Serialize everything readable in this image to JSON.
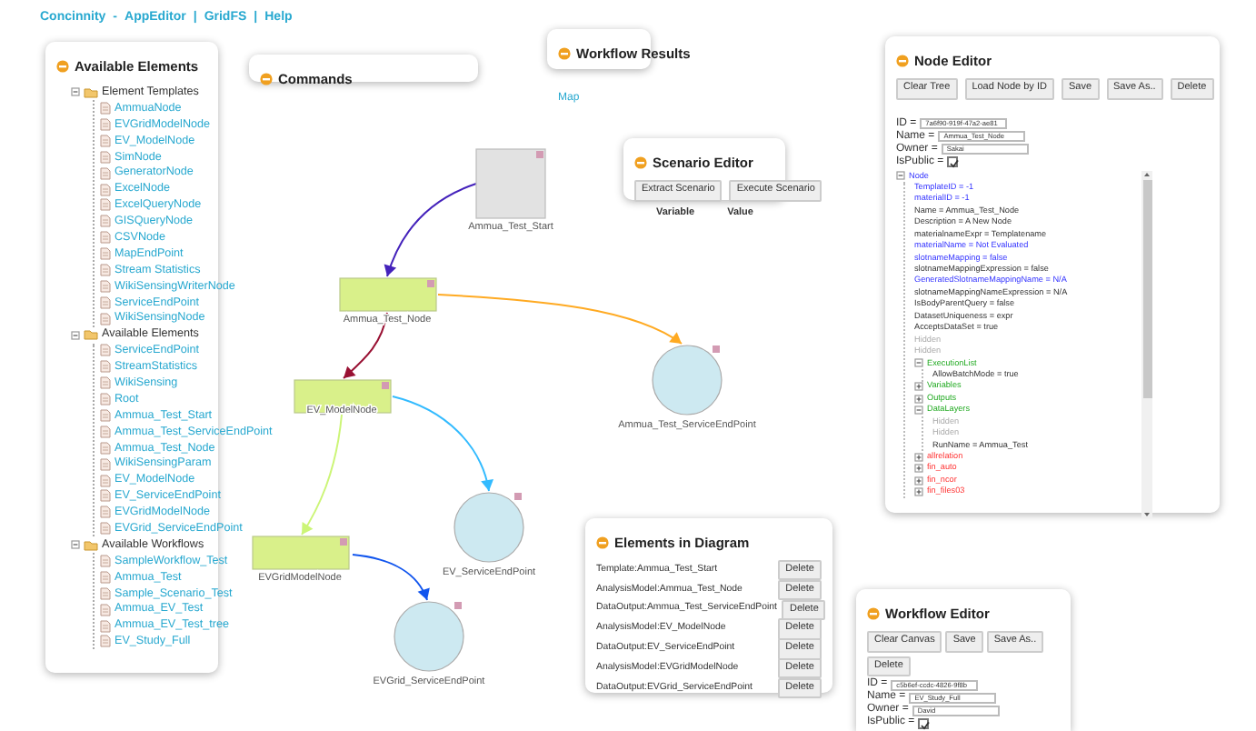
{
  "top_nav": {
    "links": [
      "Concinnity",
      "AppEditor",
      "GridFS",
      "Help"
    ],
    "separators": [
      "-",
      "|",
      "|"
    ]
  },
  "available_elements": {
    "title": "Available Elements",
    "tree": [
      {
        "label": "Element Templates",
        "expanded": true,
        "children": [
          {
            "label": "AmmuaNode"
          },
          {
            "label": "EVGridModelNode"
          },
          {
            "label": "EV_ModelNode"
          },
          {
            "label": "SimNode"
          },
          {
            "label": "GeneratorNode"
          },
          {
            "label": "ExcelNode"
          },
          {
            "label": "ExcelQueryNode"
          },
          {
            "label": "GISQueryNode"
          },
          {
            "label": "CSVNode"
          },
          {
            "label": "MapEndPoint"
          },
          {
            "label": "Stream Statistics"
          },
          {
            "label": "WikiSensingWriterNode"
          },
          {
            "label": "ServiceEndPoint"
          },
          {
            "label": "WikiSensingNode"
          }
        ]
      },
      {
        "label": "Available Elements",
        "expanded": true,
        "children": [
          {
            "label": "ServiceEndPoint"
          },
          {
            "label": "StreamStatistics"
          },
          {
            "label": "WikiSensing"
          },
          {
            "label": "Root"
          },
          {
            "label": "Ammua_Test_Start"
          },
          {
            "label": "Ammua_Test_ServiceEndPoint"
          },
          {
            "label": "Ammua_Test_Node"
          },
          {
            "label": "WikiSensingParam"
          },
          {
            "label": "EV_ModelNode"
          },
          {
            "label": "EV_ServiceEndPoint"
          },
          {
            "label": "EVGridModelNode"
          },
          {
            "label": "EVGrid_ServiceEndPoint"
          }
        ]
      },
      {
        "label": "Available Workflows",
        "expanded": true,
        "children": [
          {
            "label": "SampleWorkflow_Test"
          },
          {
            "label": "Ammua_Test"
          },
          {
            "label": "Sample_Scenario_Test"
          },
          {
            "label": "Ammua_EV_Test"
          },
          {
            "label": "Ammua_EV_Test_tree"
          },
          {
            "label": "EV_Study_Full"
          }
        ]
      }
    ]
  },
  "commands": {
    "title": "Commands"
  },
  "workflow_results": {
    "title": "Workflow Results",
    "links": [
      "Map"
    ]
  },
  "scenario_editor": {
    "title": "Scenario Editor",
    "buttons": [
      "Extract Scenario",
      "Execute Scenario"
    ],
    "columns": [
      "Variable",
      "Value"
    ]
  },
  "diagram": {
    "nodes": [
      {
        "label": "Ammua_Test_Start",
        "kind": "template"
      },
      {
        "label": "Ammua_Test_Node",
        "kind": "model"
      },
      {
        "label": "EV_ModelNode",
        "kind": "model"
      },
      {
        "label": "EVGridModelNode",
        "kind": "model"
      },
      {
        "label": "Ammua_Test_ServiceEndPoint",
        "kind": "endpoint"
      },
      {
        "label": "EV_ServiceEndPoint",
        "kind": "endpoint"
      },
      {
        "label": "EVGrid_ServiceEndPoint",
        "kind": "endpoint"
      }
    ],
    "edges": [
      {
        "color": "#4422bb"
      },
      {
        "color": "#ffaa22"
      },
      {
        "color": "#991133"
      },
      {
        "color": "#33bbff"
      },
      {
        "color": "#ccf577"
      },
      {
        "color": "#1155ee"
      }
    ]
  },
  "node_editor": {
    "title": "Node Editor",
    "buttons": [
      "Clear Tree",
      "Load Node by ID",
      "Save",
      "Save As..",
      "Delete"
    ],
    "fields": [
      {
        "label": "ID =",
        "value": "7a6f90-919f-47a2-ae81"
      },
      {
        "label": "Name =",
        "value": "Ammua_Test_Node"
      },
      {
        "label": "Owner =",
        "value": "Sakai"
      }
    ],
    "is_public": {
      "label": "IsPublic =",
      "checked": true
    },
    "tree": [
      {
        "label": "Node",
        "kind": "special",
        "expanded": true,
        "children": [
          {
            "label": "TemplateID = -1",
            "kind": "special"
          },
          {
            "label": "materialID = -1",
            "kind": "special"
          },
          {
            "label": "Name = Ammua_Test_Node",
            "kind": "plain"
          },
          {
            "label": "Description = A New Node",
            "kind": "plain"
          },
          {
            "label": "materialnameExpr = Templatename",
            "kind": "plain"
          },
          {
            "label": "materialName = Not Evaluated",
            "kind": "special"
          },
          {
            "label": "slotnameMapping = false",
            "kind": "special"
          },
          {
            "label": "slotnameMappingExpression = false",
            "kind": "plain"
          },
          {
            "label": "GeneratedSlotnameMappingName = N/A",
            "kind": "special"
          },
          {
            "label": "slotnameMappingNameExpression = N/A",
            "kind": "plain"
          },
          {
            "label": "IsBodyParentQuery = false",
            "kind": "plain"
          },
          {
            "label": "DatasetUniqueness = expr",
            "kind": "plain"
          },
          {
            "label": "AcceptsDataSet = true",
            "kind": "plain"
          },
          {
            "label": "Hidden",
            "kind": "hidden"
          },
          {
            "label": "Hidden",
            "kind": "hidden"
          },
          {
            "label": "ExecutionList",
            "kind": "group",
            "expanded": true,
            "children": [
              {
                "label": "AllowBatchMode = true",
                "kind": "plain"
              }
            ]
          },
          {
            "label": "Variables",
            "kind": "group",
            "expanded": false
          },
          {
            "label": "Outputs",
            "kind": "group",
            "expanded": false
          },
          {
            "label": "DataLayers",
            "kind": "group",
            "expanded": true,
            "children": [
              {
                "label": "Hidden",
                "kind": "hidden"
              },
              {
                "label": "Hidden",
                "kind": "hidden"
              },
              {
                "label": "RunName = Ammua_Test",
                "kind": "plain"
              }
            ]
          },
          {
            "label": "allrelation",
            "kind": "relation",
            "expanded": false
          },
          {
            "label": "fin_auto",
            "kind": "relation",
            "expanded": false
          },
          {
            "label": "fin_ncor",
            "kind": "relation",
            "expanded": false
          },
          {
            "label": "fin_files03",
            "kind": "relation",
            "expanded": false
          }
        ]
      }
    ]
  },
  "elements_in_diagram": {
    "title": "Elements in Diagram",
    "rows": [
      {
        "label": "Template:Ammua_Test_Start",
        "button": "Delete"
      },
      {
        "label": "AnalysisModel:Ammua_Test_Node",
        "button": "Delete"
      },
      {
        "label": "DataOutput:Ammua_Test_ServiceEndPoint",
        "button": "Delete"
      },
      {
        "label": "AnalysisModel:EV_ModelNode",
        "button": "Delete"
      },
      {
        "label": "DataOutput:EV_ServiceEndPoint",
        "button": "Delete"
      },
      {
        "label": "AnalysisModel:EVGridModelNode",
        "button": "Delete"
      },
      {
        "label": "DataOutput:EVGrid_ServiceEndPoint",
        "button": "Delete"
      }
    ]
  },
  "workflow_editor": {
    "title": "Workflow Editor",
    "buttons": [
      "Clear Canvas",
      "Save",
      "Save As..",
      "Delete"
    ],
    "fields": [
      {
        "label": "ID =",
        "value": "c5b6ef-ccdc-4826-9f8b"
      },
      {
        "label": "Name =",
        "value": "EV_Study_Full"
      },
      {
        "label": "Owner =",
        "value": "David"
      }
    ],
    "is_public": {
      "label": "IsPublic =",
      "checked": true
    }
  }
}
